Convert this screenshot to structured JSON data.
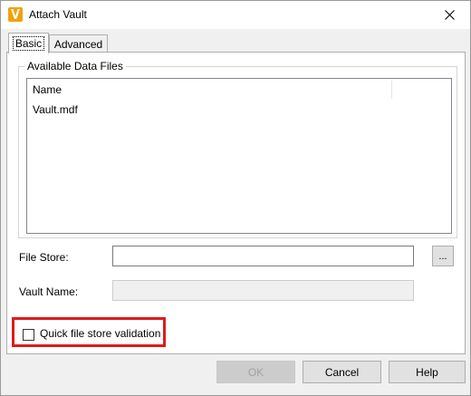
{
  "window": {
    "title": "Attach Vault",
    "icon": "vault-app-icon",
    "accent_color": "#f2a20c"
  },
  "tabs": [
    {
      "label": "Basic",
      "active": true
    },
    {
      "label": "Advanced",
      "active": false
    }
  ],
  "data_files": {
    "group_title": "Available Data Files",
    "column_header": "Name",
    "rows": [
      "Vault.mdf"
    ]
  },
  "file_store": {
    "label": "File Store:",
    "value": "",
    "browse_label": "..."
  },
  "vault_name": {
    "label": "Vault Name:",
    "value": "",
    "enabled": false
  },
  "quick_validation": {
    "label": "Quick file store validation",
    "checked": false,
    "highlight_color": "#e01a1a"
  },
  "buttons": {
    "ok": "OK",
    "cancel": "Cancel",
    "help": "Help",
    "ok_enabled": false
  }
}
